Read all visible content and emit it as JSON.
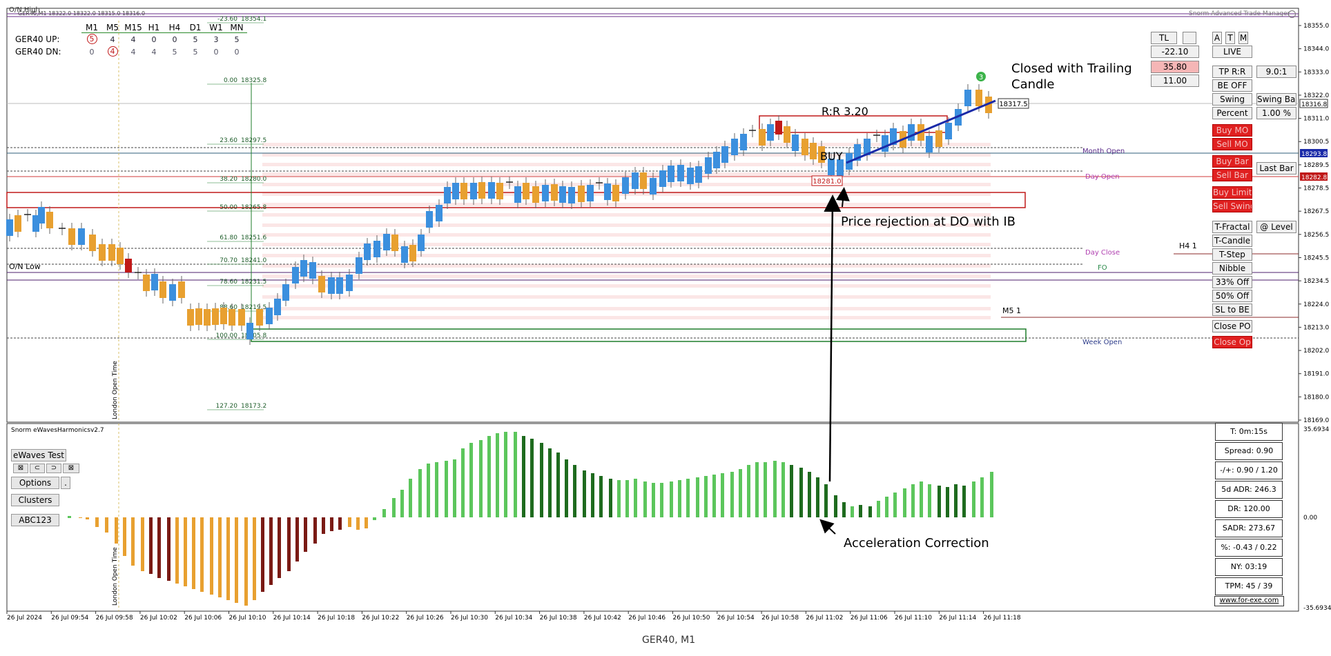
{
  "window": {
    "symbol_title": "GER40, M1",
    "ohlc_header": "GER40,M1  18322.0 18322.0 18315.0 18316.0",
    "manager_title": "Snorm Advanced Trade Manager"
  },
  "strength_table": {
    "headers": [
      "M1",
      "M5",
      "M15",
      "H1",
      "H4",
      "D1",
      "W1",
      "MN"
    ],
    "rows": [
      {
        "label": "GER40 UP:",
        "values": [
          "5",
          "4",
          "4",
          "0",
          "0",
          "5",
          "3",
          "5"
        ],
        "circled": [
          0
        ]
      },
      {
        "label": "GER40 DN:",
        "values": [
          "0",
          "4",
          "4",
          "4",
          "5",
          "5",
          "0",
          "0"
        ],
        "circled": [
          1
        ]
      }
    ]
  },
  "price_axis": {
    "labels": [
      "18355.0",
      "18344.0",
      "18333.0",
      "18322.0",
      "18311.0",
      "18300.5",
      "18289.5",
      "18278.5",
      "18267.5",
      "18256.5",
      "18245.5",
      "18234.5",
      "18224.0",
      "18213.0",
      "18202.0",
      "18191.0",
      "18180.0",
      "18169.0"
    ],
    "current_price": "18316.8",
    "badge_blue": "18293.8",
    "badge_red": "18282.8"
  },
  "indicator_axis": {
    "top": "35.6934",
    "zero": "0.00",
    "bottom": "-35.6934"
  },
  "time_axis": [
    "26 Jul 2024",
    "26 Jul 09:54",
    "26 Jul 09:58",
    "26 Jul 10:02",
    "26 Jul 10:06",
    "26 Jul 10:10",
    "26 Jul 10:14",
    "26 Jul 10:18",
    "26 Jul 10:22",
    "26 Jul 10:26",
    "26 Jul 10:30",
    "26 Jul 10:34",
    "26 Jul 10:38",
    "26 Jul 10:42",
    "26 Jul 10:46",
    "26 Jul 10:50",
    "26 Jul 10:54",
    "26 Jul 10:58",
    "26 Jul 11:02",
    "26 Jul 11:06",
    "26 Jul 11:10",
    "26 Jul 11:14",
    "26 Jul 11:18"
  ],
  "fib_levels": [
    {
      "pct": "-23.60",
      "price": "18354.1"
    },
    {
      "pct": "0.00",
      "price": "18325.8"
    },
    {
      "pct": "23.60",
      "price": "18297.5"
    },
    {
      "pct": "38.20",
      "price": "18280.0"
    },
    {
      "pct": "50.00",
      "price": "18265.8"
    },
    {
      "pct": "61.80",
      "price": "18251.6"
    },
    {
      "pct": "70.70",
      "price": "18241.0"
    },
    {
      "pct": "78.60",
      "price": "18231.5"
    },
    {
      "pct": "88.60",
      "price": "18219.5"
    },
    {
      "pct": "100.00",
      "price": "18205.8"
    },
    {
      "pct": "127.20",
      "price": "18173.2"
    }
  ],
  "level_labels": {
    "on_high": "O/N High",
    "on_low": "O/N Low",
    "month_open": "Month Open",
    "day_open": "Day Open",
    "day_close": "Day Close",
    "fo": "FO",
    "week_open": "Week Open",
    "h4": "H4 1",
    "m5": "M5 1",
    "london_open": "London Open Time",
    "london_open_2": "London Open Time"
  },
  "chart_labels": {
    "rr": "R:R 3.20",
    "buy": "BUY",
    "entry_price": "18281.0",
    "tp_price": "18317.5",
    "trail_num": "3"
  },
  "annotations": {
    "closed_trailing": "Closed with Trailing",
    "closed_trailing_2": "Candle",
    "price_rejection": "Price rejection at DO with IB",
    "accel_correction": "Acceleration Correction"
  },
  "trade_panel": {
    "tl": "TL",
    "a": "A",
    "t": "T",
    "m": "M",
    "live": "LIVE",
    "v1": "-22.10",
    "v2": "35.80",
    "v3": "11.00",
    "tp_rr": "TP R:R",
    "tp_rr_val": "9.0:1",
    "be_off": "BE OFF",
    "swing": "Swing",
    "swing_bar": "Swing Bar",
    "percent": "Percent",
    "percent_val": "1.00 %",
    "buy_mo": "Buy MO",
    "sell_mo": "Sell MO",
    "buy_bar": "Buy Bar",
    "sell_bar": "Sell Bar",
    "last_bar": "Last Bar",
    "buy_limit": "Buy Limit",
    "sell_swing": "Sell Swing",
    "t_fractal": "T-Fractal",
    "at_level": "@ Level",
    "t_candle": "T-Candle",
    "t_step": "T-Step",
    "nibble": "Nibble",
    "off33": "33% Off",
    "off50": "50% Off",
    "sl_be": "SL to BE",
    "close_po": "Close PO",
    "close_op": "Close Op"
  },
  "indicator": {
    "title": "Snorm eWavesHarmonicsv2.7",
    "ewaves_btn": "eWaves Test",
    "options_btn": "Options",
    "dot_btn": ".",
    "clusters_btn": "Clusters",
    "abc_btn": "ABC123"
  },
  "info_boxes": [
    "T: 0m:15s",
    "Spread: 0.90",
    "-/+: 0.90 / 1.20",
    "5d ADR: 246.3",
    "DR: 120.00",
    "SADR: 273.67",
    "%: -0.43 / 0.22",
    "NY: 03:19",
    "TPM: 45 / 39"
  ],
  "footer_link": "www.for-exe.com"
}
